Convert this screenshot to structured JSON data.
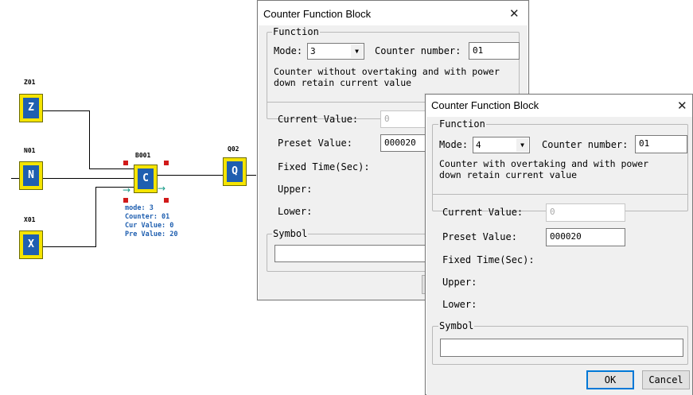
{
  "diagram": {
    "blocks": [
      {
        "id": "z01",
        "label": "Z01",
        "letter": "Z"
      },
      {
        "id": "n01",
        "label": "N01",
        "letter": "N"
      },
      {
        "id": "x01",
        "label": "X01",
        "letter": "X"
      },
      {
        "id": "b001",
        "label": "B001",
        "letter": "C"
      },
      {
        "id": "q02",
        "label": "Q02",
        "letter": "Q"
      }
    ],
    "counter_info": [
      "mode: 3",
      "Counter: 01",
      "Cur Value: 0",
      "Pre Value: 20"
    ]
  },
  "dialog_back": {
    "title": "Counter Function Block",
    "close": "✕",
    "function_legend": "Function",
    "mode_label": "Mode:",
    "mode_value": "3",
    "counter_number_label": "Counter number:",
    "counter_number_value": "01",
    "description_line1": "Counter without overtaking and with power",
    "description_line2": "down retain current value",
    "current_value_label": "Current Value:",
    "current_value": "0",
    "preset_value_label": "Preset Value:",
    "preset_value": "000020",
    "fixed_time_label": "Fixed Time(Sec):",
    "upper_label": "Upper:",
    "lower_label": "Lower:",
    "symbol_legend": "Symbol",
    "symbol_value": ""
  },
  "dialog_front": {
    "title": "Counter Function Block",
    "close": "✕",
    "function_legend": "Function",
    "mode_label": "Mode:",
    "mode_value": "4",
    "counter_number_label": "Counter number:",
    "counter_number_value": "01",
    "description_line1": "Counter with overtaking and with power",
    "description_line2": "down retain current value",
    "current_value_label": "Current Value:",
    "current_value": "0",
    "preset_value_label": "Preset Value:",
    "preset_value": "000020",
    "fixed_time_label": "Fixed Time(Sec):",
    "upper_label": "Upper:",
    "lower_label": "Lower:",
    "symbol_legend": "Symbol",
    "symbol_value": "",
    "ok_label": "OK",
    "cancel_label": "Cancel"
  },
  "colors": {
    "block_fill": "#f5e400",
    "block_inner": "#1f5fb0",
    "handle": "#d11a1a",
    "info_text": "#1f5fb0",
    "dialog_bg": "#f0f0f0"
  }
}
